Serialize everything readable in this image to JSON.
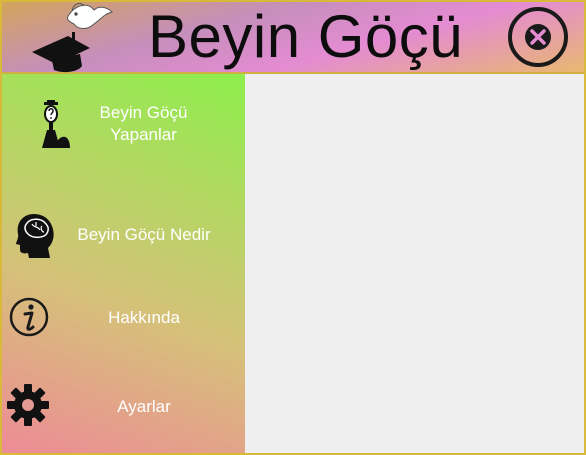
{
  "app": {
    "title": "Beyin Göçü"
  },
  "header": {
    "logo_icon": "graduate-cap-bird-logo",
    "close_icon": "close-circle-icon"
  },
  "sidebar": {
    "items": [
      {
        "label": "Beyin Göçü\nYapanlar",
        "icon": "scientist-icon"
      },
      {
        "label": "Beyin Göçü Nedir",
        "icon": "head-brain-icon"
      },
      {
        "label": "Hakkında",
        "icon": "info-icon"
      },
      {
        "label": "Ayarlar",
        "icon": "gear-icon"
      }
    ]
  },
  "colors": {
    "header_pink": "#e48bd2",
    "sidebar_green": "#8def4c",
    "sidebar_pink": "#ed8b96",
    "content_bg": "#efefef",
    "border": "#d8b93a"
  }
}
